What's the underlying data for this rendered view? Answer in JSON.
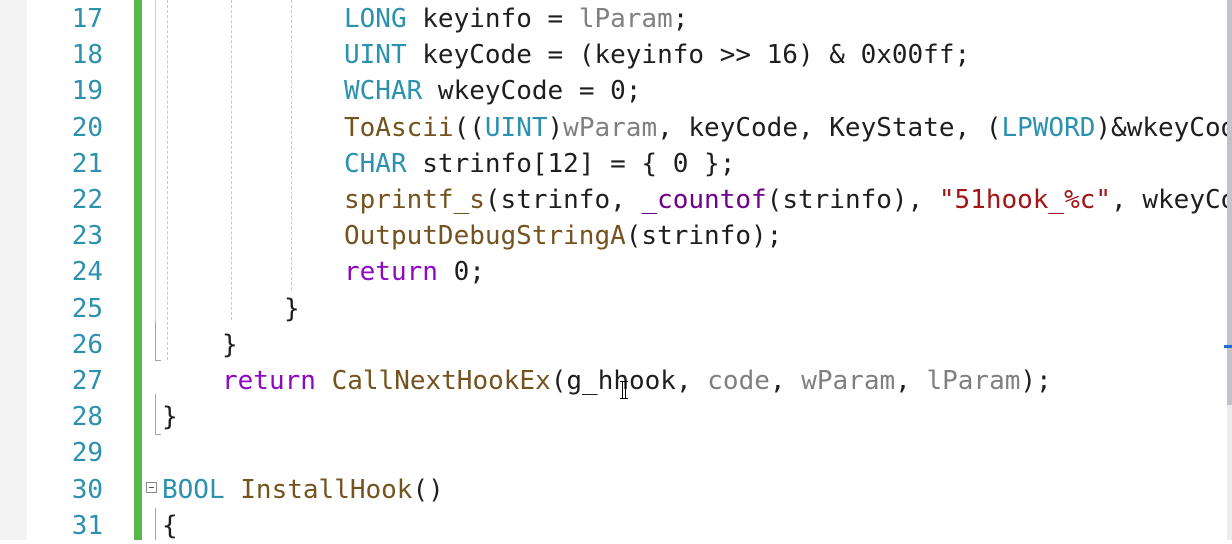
{
  "editor": {
    "line_numbers": [
      "17",
      "18",
      "19",
      "20",
      "21",
      "22",
      "23",
      "24",
      "25",
      "26",
      "27",
      "28",
      "29",
      "30",
      "31"
    ],
    "lines": [
      {
        "tokens": [
          {
            "t": "LONG",
            "c": "ty"
          },
          {
            "t": " keyinfo = ",
            "c": "plain"
          },
          {
            "t": "lParam",
            "c": "prm"
          },
          {
            "t": ";",
            "c": "plain"
          }
        ]
      },
      {
        "tokens": [
          {
            "t": "UINT",
            "c": "ty"
          },
          {
            "t": " keyCode = (keyinfo >> 16) & 0x00ff;",
            "c": "plain"
          }
        ]
      },
      {
        "tokens": [
          {
            "t": "WCHAR",
            "c": "ty"
          },
          {
            "t": " wkeyCode = 0;",
            "c": "plain"
          }
        ]
      },
      {
        "tokens": [
          {
            "t": "ToAscii",
            "c": "fn"
          },
          {
            "t": "((",
            "c": "plain"
          },
          {
            "t": "UINT",
            "c": "ty"
          },
          {
            "t": ")",
            "c": "plain"
          },
          {
            "t": "wParam",
            "c": "prm"
          },
          {
            "t": ", keyCode, KeyState, (",
            "c": "plain"
          },
          {
            "t": "LPWORD",
            "c": "ty"
          },
          {
            "t": ")&wkeyCode,",
            "c": "plain"
          }
        ]
      },
      {
        "tokens": [
          {
            "t": "CHAR",
            "c": "ty"
          },
          {
            "t": " strinfo[12] = { 0 };",
            "c": "plain"
          }
        ]
      },
      {
        "tokens": [
          {
            "t": "sprintf_s",
            "c": "fn"
          },
          {
            "t": "(strinfo, ",
            "c": "plain"
          },
          {
            "t": "_countof",
            "c": "typekw"
          },
          {
            "t": "(strinfo), ",
            "c": "plain"
          },
          {
            "t": "\"51hook_%c\"",
            "c": "str"
          },
          {
            "t": ", wkeyCode",
            "c": "plain"
          }
        ]
      },
      {
        "tokens": [
          {
            "t": "OutputDebugStringA",
            "c": "fn"
          },
          {
            "t": "(strinfo);",
            "c": "plain"
          }
        ]
      },
      {
        "tokens": [
          {
            "t": "return",
            "c": "ret"
          },
          {
            "t": " 0;",
            "c": "plain"
          }
        ]
      },
      {
        "tokens": [
          {
            "t": "}",
            "c": "plain"
          }
        ]
      },
      {
        "tokens": [
          {
            "t": "}",
            "c": "plain"
          }
        ]
      },
      {
        "tokens": [
          {
            "t": "return",
            "c": "ret"
          },
          {
            "t": " ",
            "c": "plain"
          },
          {
            "t": "CallNextHookEx",
            "c": "fn"
          },
          {
            "t": "(g_hhook, ",
            "c": "plain"
          },
          {
            "t": "code",
            "c": "prm"
          },
          {
            "t": ", ",
            "c": "plain"
          },
          {
            "t": "wParam",
            "c": "prm"
          },
          {
            "t": ", ",
            "c": "plain"
          },
          {
            "t": "lParam",
            "c": "prm"
          },
          {
            "t": ");",
            "c": "plain"
          }
        ]
      },
      {
        "tokens": [
          {
            "t": "}",
            "c": "plain"
          }
        ]
      },
      {
        "tokens": []
      },
      {
        "tokens": [
          {
            "t": "BOOL",
            "c": "ty"
          },
          {
            "t": " InstallHook",
            "c": "fn"
          },
          {
            "t": "()",
            "c": "plain"
          }
        ]
      },
      {
        "tokens": [
          {
            "t": "{",
            "c": "plain"
          }
        ]
      }
    ]
  },
  "colors": {
    "line_number": "#2b91af",
    "change_bar": "#57b947",
    "type": "#2b91af",
    "parameter": "#808080",
    "string": "#a31515",
    "function": "#74531f",
    "control_keyword": "#8f08c4",
    "macro": "#6f008a"
  }
}
